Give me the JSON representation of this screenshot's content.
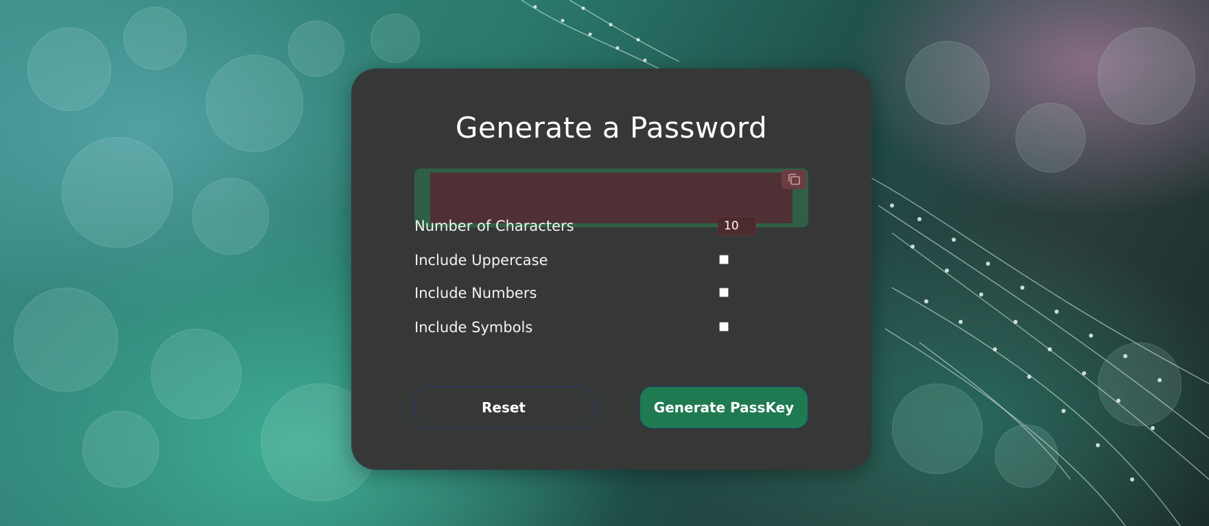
{
  "page": {
    "title": "Generate a Password"
  },
  "output": {
    "value": "",
    "copy_icon": "copy-icon"
  },
  "options": {
    "characters_label": "Number of Characters",
    "characters_value": "10",
    "uppercase_label": "Include Uppercase",
    "uppercase_checked": false,
    "numbers_label": "Include Numbers",
    "numbers_checked": false,
    "symbols_label": "Include Symbols",
    "symbols_checked": false
  },
  "buttons": {
    "reset_label": "Reset",
    "generate_label": "Generate PassKey"
  },
  "colors": {
    "card": "#363837",
    "output_frame": "#2f5f45",
    "output_field": "#4f3034",
    "generate_button": "#1f7a52"
  }
}
